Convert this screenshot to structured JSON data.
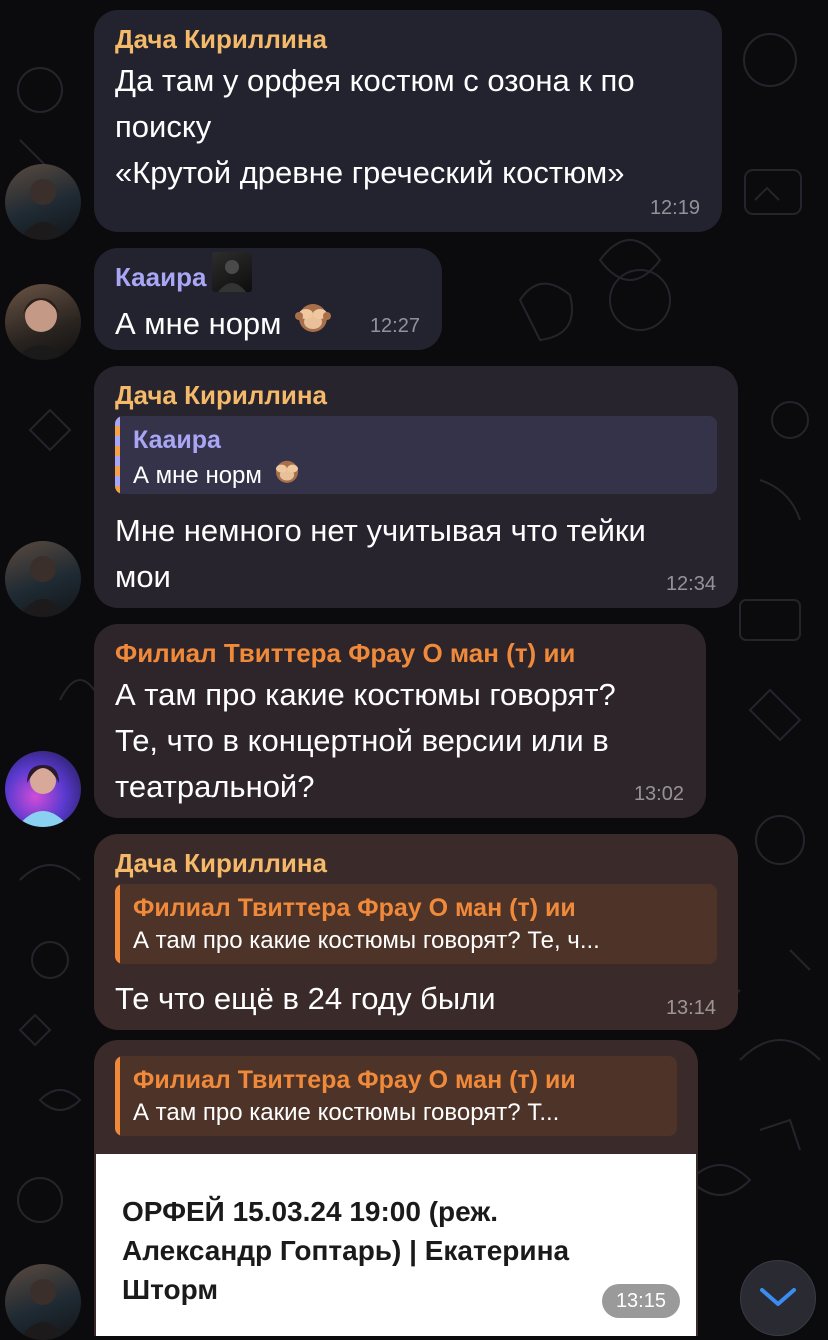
{
  "colors": {
    "background": "#0b0b0d",
    "incoming_dark": "#23232f",
    "incoming_warm": "#3a2a2a",
    "name_kirillina": "#f5b96a",
    "name_kaaira": "#a9a6f5",
    "name_filial": "#f08a3a",
    "scroll_button": "#2a2a33",
    "scroll_arrow": "#3a8cf0"
  },
  "messages": [
    {
      "sender": "Дача Кириллина",
      "lines": [
        "Да там у орфея костюм с озона к по",
        "поиску",
        "«Крутой древне греческий костюм»"
      ],
      "time": "12:19"
    },
    {
      "sender": "Кааира",
      "text": "А мне норм",
      "emoji": "see-no-evil-monkey",
      "time": "12:27"
    },
    {
      "sender": "Дача Кириллина",
      "reply": {
        "name": "Кааира",
        "text": "А мне норм"
      },
      "lines": [
        "Мне немного нет учитывая что тейки",
        "мои"
      ],
      "time": "12:34"
    },
    {
      "sender": "Филиал Твиттера Фрау О ман (т) ии",
      "lines": [
        "А там про какие костюмы говорят?",
        "Те, что в концертной версии или в",
        "театральной?"
      ],
      "time": "13:02"
    },
    {
      "sender": "Дача Кириллина",
      "reply": {
        "name": "Филиал Твиттера Фрау О ман (т) ии",
        "text": "А там про какие костюмы говорят? Те, ч..."
      },
      "text": "Те что ещё в 24 году были",
      "time": "13:14"
    },
    {
      "reply": {
        "name": "Филиал Твиттера Фрау О ман (т) ии",
        "text": "А там про какие костюмы говорят? Т..."
      },
      "link_card_lines": [
        "ОРФЕЙ 15.03.24 19:00 (реж.",
        "Александр Гоптарь) | Екатерина",
        "Шторм"
      ],
      "time": "13:15"
    }
  ],
  "icons": {
    "scroll_down": "chevron-down-icon"
  }
}
